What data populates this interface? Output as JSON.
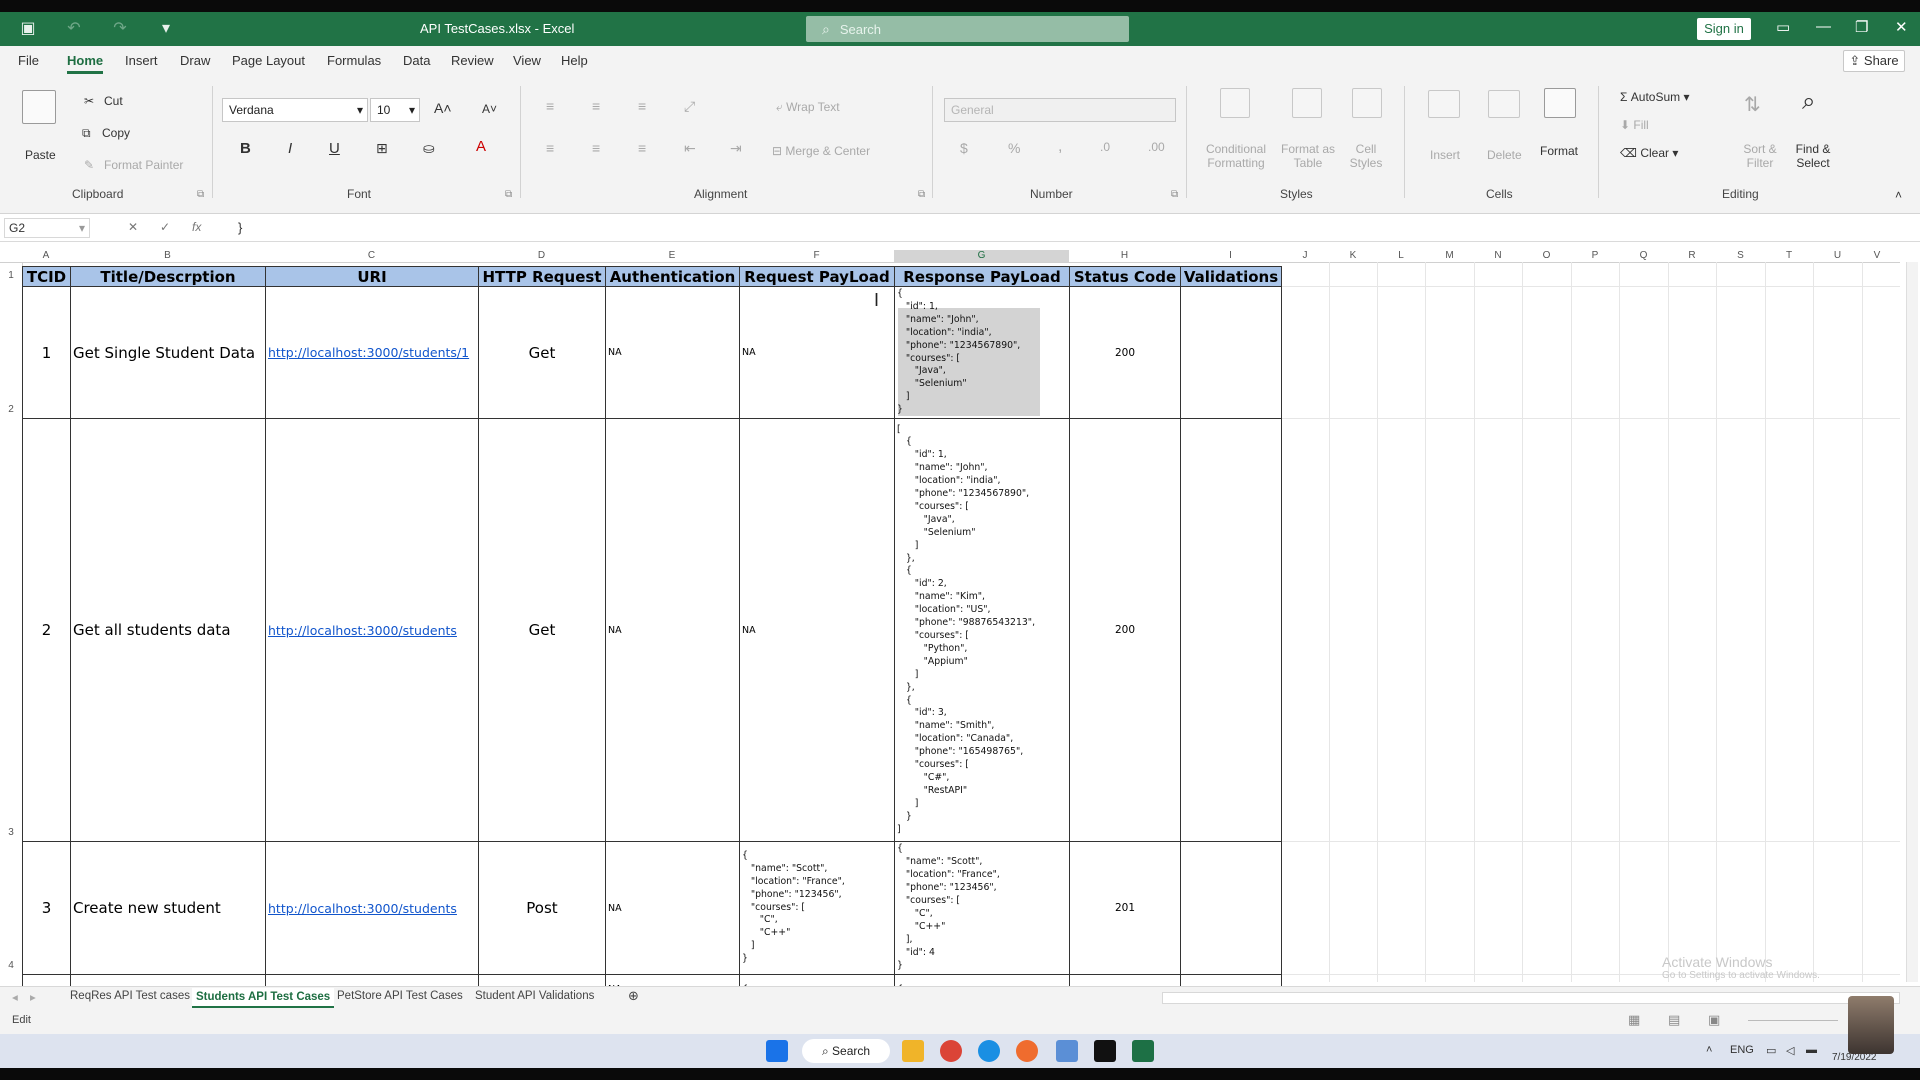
{
  "window": {
    "title": "API TestCases.xlsx  -  Excel",
    "search_placeholder": "Search",
    "sign_in": "Sign in"
  },
  "menu": {
    "tabs": [
      "File",
      "Home",
      "Insert",
      "Draw",
      "Page Layout",
      "Formulas",
      "Data",
      "Review",
      "View",
      "Help"
    ],
    "active": "Home",
    "share": "Share"
  },
  "ribbon": {
    "clipboard": {
      "paste": "Paste",
      "cut": "Cut",
      "copy": "Copy",
      "format_painter": "Format Painter",
      "label": "Clipboard"
    },
    "font": {
      "name": "Verdana",
      "size": "10",
      "label": "Font"
    },
    "alignment": {
      "wrap_text": "Wrap Text",
      "merge_center": "Merge & Center",
      "label": "Alignment"
    },
    "number": {
      "format": "General",
      "label": "Number"
    },
    "styles": {
      "conditional": "Conditional",
      "conditional2": "Formatting",
      "format_as": "Format as",
      "format_as2": "Table",
      "cell": "Cell",
      "cell2": "Styles",
      "label": "Styles"
    },
    "cells": {
      "insert": "Insert",
      "delete": "Delete",
      "format": "Format",
      "label": "Cells"
    },
    "editing": {
      "autosum": "AutoSum",
      "fill": "Fill",
      "clear": "Clear",
      "sort": "Sort &",
      "sort2": "Filter",
      "find": "Find &",
      "find2": "Select",
      "label": "Editing"
    }
  },
  "formula_bar": {
    "name_box": "G2",
    "value": "}"
  },
  "columns": [
    "A",
    "B",
    "C",
    "D",
    "E",
    "F",
    "G",
    "H",
    "I",
    "J",
    "K",
    "L",
    "M",
    "N",
    "O",
    "P",
    "Q",
    "R",
    "S",
    "T",
    "U",
    "V"
  ],
  "rows": [
    "1",
    "2",
    "3",
    "4"
  ],
  "headers": [
    "TCID",
    "Title/Descrption",
    "URI",
    "HTTP Request",
    "Authentication",
    "Request PayLoad",
    "Response PayLoad",
    "Status Code",
    "Validations"
  ],
  "records": [
    {
      "tcid": "1",
      "title": "Get Single Student Data",
      "uri": "http://localhost:3000/students/1",
      "http": "Get",
      "auth": "NA",
      "request": "NA",
      "response": "{\n   \"id\": 1,\n   \"name\": \"John\",\n   \"location\": \"india\",\n   \"phone\": \"1234567890\",\n   \"courses\": [\n      \"Java\",\n      \"Selenium\"\n   ]\n}",
      "status": "200"
    },
    {
      "tcid": "2",
      "title": "Get all students data",
      "uri": "http://localhost:3000/students",
      "http": "Get",
      "auth": "NA",
      "request": "NA",
      "response": "[\n   {\n      \"id\": 1,\n      \"name\": \"John\",\n      \"location\": \"india\",\n      \"phone\": \"1234567890\",\n      \"courses\": [\n         \"Java\",\n         \"Selenium\"\n      ]\n   },\n   {\n      \"id\": 2,\n      \"name\": \"Kim\",\n      \"location\": \"US\",\n      \"phone\": \"98876543213\",\n      \"courses\": [\n         \"Python\",\n         \"Appium\"\n      ]\n   },\n   {\n      \"id\": 3,\n      \"name\": \"Smith\",\n      \"location\": \"Canada\",\n      \"phone\": \"165498765\",\n      \"courses\": [\n         \"C#\",\n         \"RestAPI\"\n      ]\n   }\n]",
      "status": "200"
    },
    {
      "tcid": "3",
      "title": "Create new student",
      "uri": "http://localhost:3000/students",
      "http": "Post",
      "auth": "NA",
      "request": "{\n   \"name\": \"Scott\",\n   \"location\": \"France\",\n   \"phone\": \"123456\",\n   \"courses\": [\n      \"C\",\n      \"C++\"\n   ]\n}",
      "response": "{\n   \"name\": \"Scott\",\n   \"location\": \"France\",\n   \"phone\": \"123456\",\n   \"courses\": [\n      \"C\",\n      \"C++\"\n   ],\n   \"id\": 4\n}",
      "status": "201"
    },
    {
      "tcid": "",
      "title": "",
      "uri": "",
      "http": "",
      "auth": "NA",
      "request": "{",
      "response": "{",
      "status": ""
    }
  ],
  "sheet_tabs": [
    "ReqRes API Test cases",
    "Students API Test Cases",
    "PetStore API Test Cases",
    "Student API Validations"
  ],
  "active_sheet": "Students API Test Cases",
  "status_mode": "Edit",
  "watermark": {
    "line1": "Activate Windows",
    "line2": "Go to Settings to activate Windows."
  },
  "taskbar": {
    "search": "Search",
    "lang": "ENG",
    "date": "7/19/2022"
  }
}
